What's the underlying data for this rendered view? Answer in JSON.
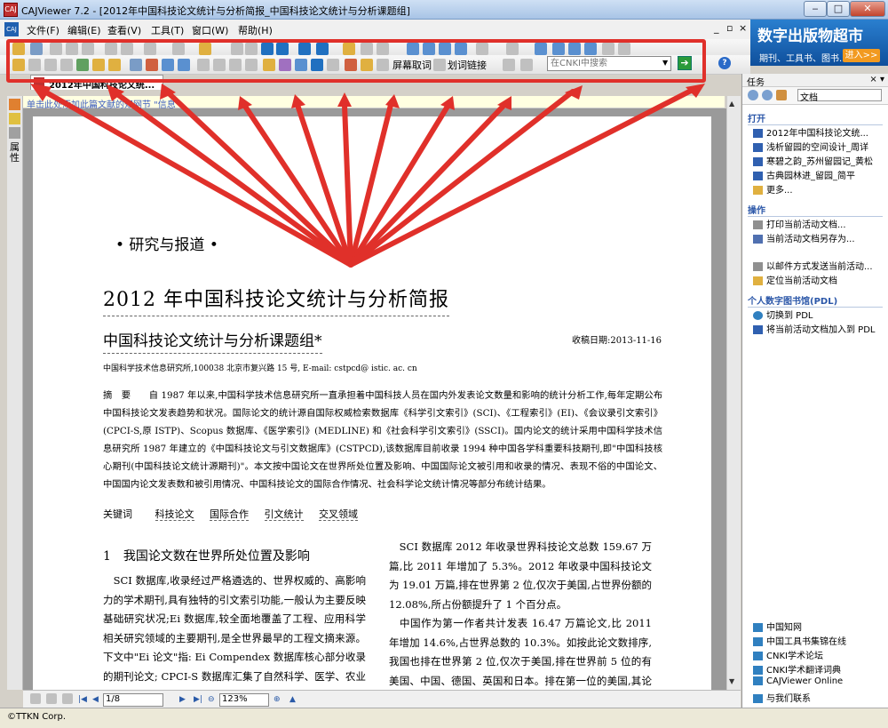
{
  "window": {
    "title": "CAJViewer 7.2 - [2012年中国科技论文统计与分析简报_中国科技论文统计与分析课题组]"
  },
  "menu": {
    "items": [
      "文件(F)",
      "编辑(E)",
      "查看(V)",
      "工具(T)",
      "窗口(W)",
      "帮助(H)"
    ]
  },
  "banner": {
    "title": "数字出版物超市",
    "subtitle": "期刊、工具书、图书...",
    "enter": "进入>>"
  },
  "toolbar": {
    "screen_word": "屏幕取词",
    "word_link": "划词链接",
    "search_placeholder": "在CNKI中搜索"
  },
  "doc_tab": {
    "label": "2012年中国科技论文统..."
  },
  "sidebar": {
    "vertical_text": "属\n性"
  },
  "infobar": {
    "text": "单击此处添加此篇文献的知网节 \"信息"
  },
  "page": {
    "section": "• 研究与报道 •",
    "title": "2012 年中国科技论文统计与分析简报",
    "author": "中国科技论文统计与分析课题组*",
    "received": "收稿日期:2013-11-16",
    "affiliation": "中国科学技术信息研究所,100038  北京市复兴路 15 号, E-mail: cstpcd@ istic. ac. cn",
    "abstract": "摘　要　　自 1987 年以来,中国科学技术信息研究所一直承担着中国科技人员在国内外发表论文数量和影响的统计分析工作,每年定期公布中国科技论文发表趋势和状况。国际论文的统计源自国际权威检索数据库《科学引文索引》(SCI)、《工程索引》(EI)、《会议录引文索引》(CPCI-S,原 ISTP)、Scopus 数据库、《医学索引》(MEDLINE) 和《社会科学引文索引》(SSCI)。国内论文的统计采用中国科学技术信息研究所 1987 年建立的《中国科技论文与引文数据库》(CSTPCD),该数据库目前收录 1994 种中国各学科重要科技期刊,即\"中国科技核心期刊(中国科技论文统计源期刊)\"。本文按中国论文在世界所处位置及影响、中国国际论文被引用和收录的情况、表现不俗的中国论文、中国国内论文发表数和被引用情况、中国科技论文的国际合作情况、社会科学论文统计情况等部分布统计结果。",
    "keywords_label": "关键词",
    "keywords": [
      "科技论文",
      "国际合作",
      "引文统计",
      "交叉领域"
    ],
    "heading1": "1　我国论文数在世界所处位置及影响",
    "left_col": "　SCI 数据库,收录经过严格遴选的、世界权威的、高影响力的学术期刊,具有独特的引文索引功能,一般认为主要反映基础研究状况;Ei 数据库,较全面地覆盖了工程、应用科学相关研究领域的主要期刊,是全世界最早的工程文摘来源。下文中\"Ei 论文\"指: Ei Compendex 数据库核心部分收录的期刊论文; CPCI-S 数据库汇集了自然科学、医学、农业科学和工程技术等多个领域每年全世界出版的会议文献的",
    "right_col": "　SCI 数据库 2012 年收录世界科技论文总数 159.67 万篇,比 2011 年增加了 5.3%。2012 年收录中国科技论文为 19.01 万篇,排在世界第 2 位,仅次于美国,占世界份额的 12.08%,所占份额提升了 1 个百分点。\n　中国作为第一作者共计发表 16.47 万篇论文,比 2011 年增加 14.6%,占世界总数的 10.3%。如按此论文数排序,我国也排在世界第 2 位,仅次于美国,排在世界前 5 位的有美国、中国、德国、英国和日本。排在第一位的美国,其论文数量为 43.6 万篇,是我国的 2.3 倍,占世界份额"
  },
  "nav": {
    "page": "1/8",
    "zoom": "123%"
  },
  "status": {
    "text": "©TTKN Corp."
  },
  "task": {
    "header": "任务",
    "nav_label": "文档",
    "sec_open": "打开",
    "open_items": [
      "2012年中国科技论文统...",
      "浅析留园的空间设计_周详",
      "寒碧之韵_苏州留园记_黄松",
      "古典园林进_留园_简平",
      "更多..."
    ],
    "sec_ops": "操作",
    "ops_items": [
      "打印当前活动文档...",
      "当前活动文档另存为...",
      "以邮件方式发送当前活动...",
      "定位当前活动文档"
    ],
    "sec_pdl": "个人数字图书馆(PDL)",
    "pdl_items": [
      "切换到 PDL",
      "将当前活动文档加入到 PDL"
    ],
    "links": [
      "中国知网",
      "中国工具书集锦在线",
      "CNKI学术论坛",
      "CNKI学术翻译词典",
      "CAJViewer Online",
      "与我们联系"
    ]
  }
}
